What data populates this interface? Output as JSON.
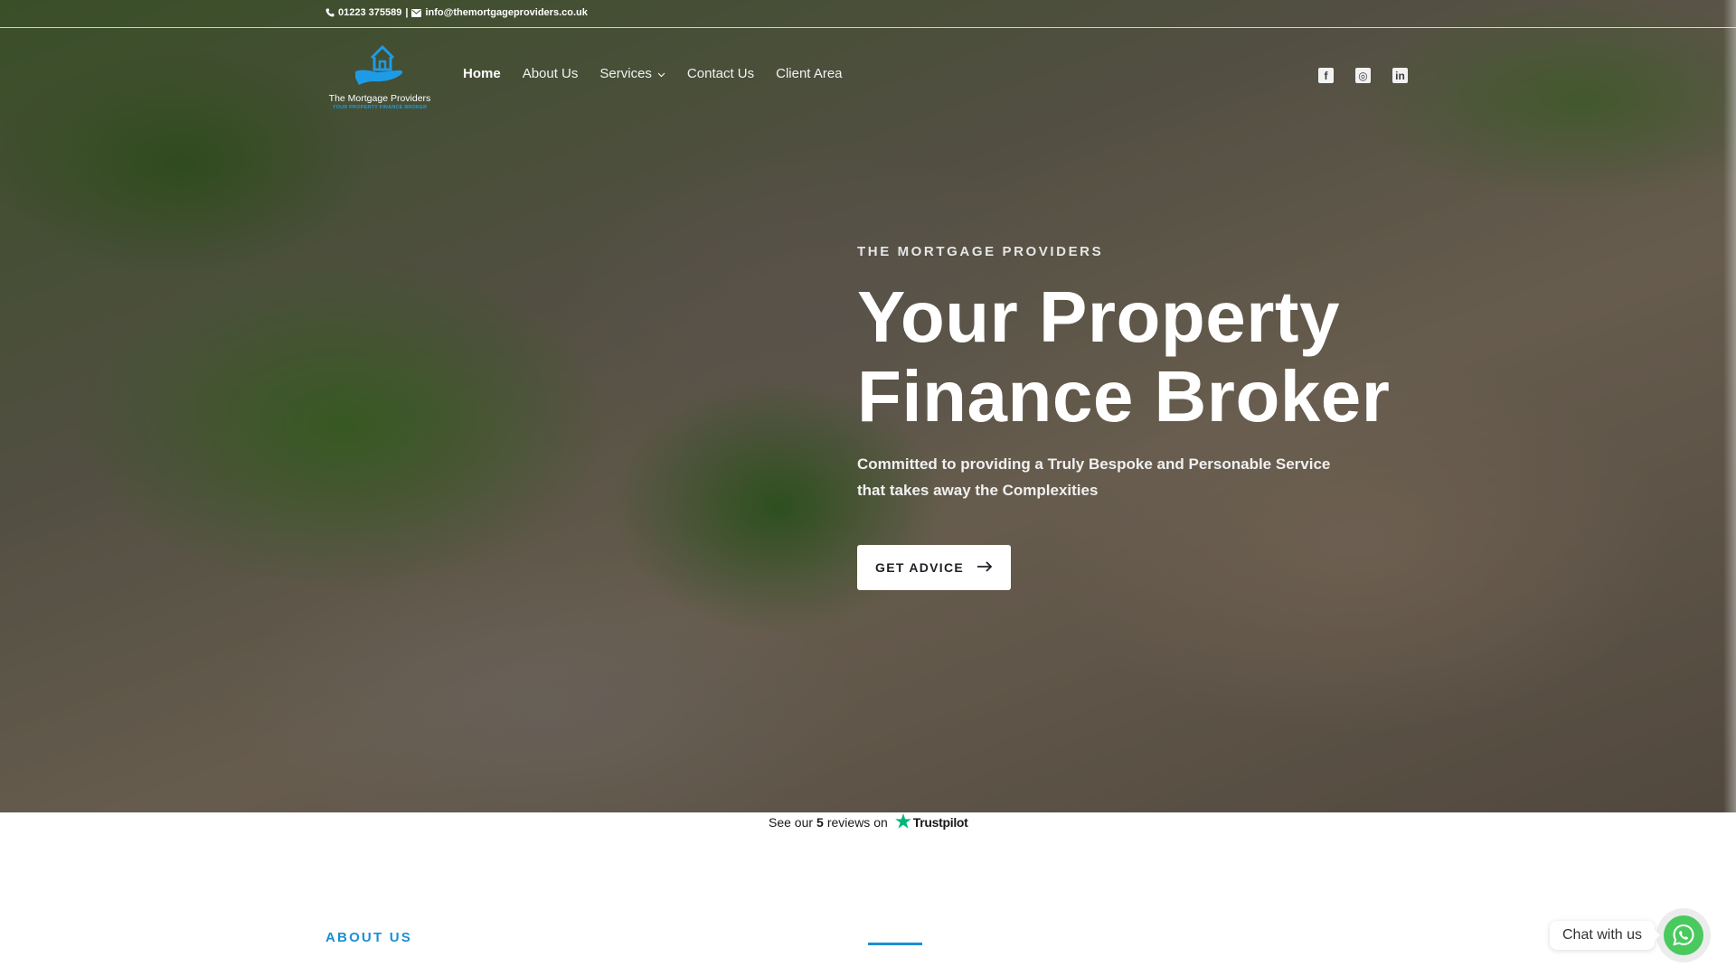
{
  "topbar": {
    "phone": "01223 375589",
    "separator": "|",
    "email": "info@themortgageproviders.co.uk"
  },
  "logo": {
    "name": "The Mortgage Providers",
    "tagline": "YOUR PROPERTY FINANCE BROKER",
    "color": "#1e9be6"
  },
  "nav": {
    "items": [
      {
        "label": "Home",
        "active": true
      },
      {
        "label": "About Us"
      },
      {
        "label": "Services",
        "dropdown": true
      },
      {
        "label": "Contact Us"
      },
      {
        "label": "Client Area"
      }
    ]
  },
  "social": [
    {
      "icon": "facebook-icon",
      "glyph": "f"
    },
    {
      "icon": "instagram-icon",
      "glyph": "◎"
    },
    {
      "icon": "linkedin-icon",
      "glyph": "in"
    }
  ],
  "hero": {
    "eyebrow": "THE MORTGAGE PROVIDERS",
    "headline_line1": "Your Property",
    "headline_line2": "Finance Broker",
    "subtext_line1": "Committed to providing a Truly Bespoke and Personable Service",
    "subtext_line2": "that takes away the Complexities",
    "cta_label": "GET ADVICE"
  },
  "trustpilot": {
    "prefix": "See our",
    "count": "5",
    "middle": "reviews on",
    "brand": "Trustpilot",
    "star_color": "#00b67a"
  },
  "about": {
    "label": "ABOUT US",
    "accent": "#1a8fd6"
  },
  "chat": {
    "label": "Chat with us",
    "button_color": "#4ac95f"
  }
}
